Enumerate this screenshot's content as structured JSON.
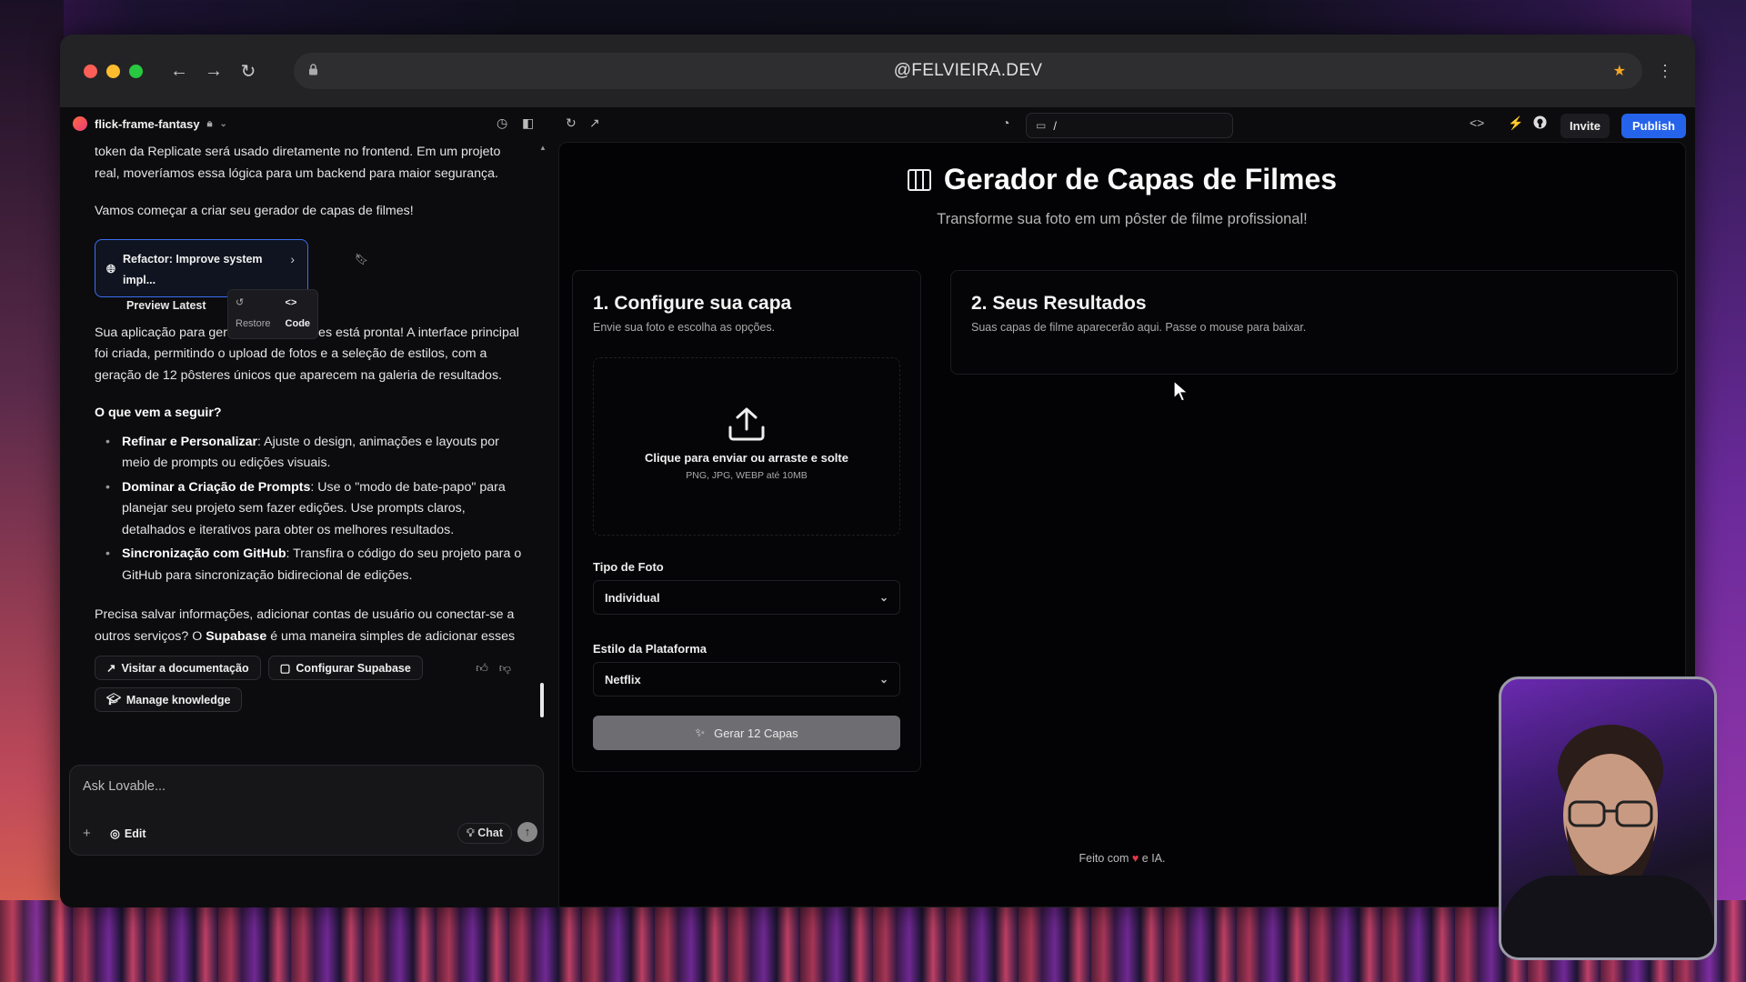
{
  "browser": {
    "url": "@FELVIEIRA.DEV"
  },
  "topbar": {
    "project_name": "flick-frame-fantasy",
    "route": "/",
    "invite_label": "Invite",
    "publish_label": "Publish"
  },
  "chat": {
    "paragraph1": "token da Replicate será usado diretamente no frontend. Em um projeto real, moveríamos essa lógica para um backend para maior segurança.",
    "paragraph2": "Vamos começar a criar seu gerador de capas de filmes!",
    "version_card": {
      "title": "Refactor: Improve system impl...",
      "subtitle": "Preview Latest",
      "restore_label": "Restore",
      "code_label": "Code"
    },
    "paragraph3": "Sua aplicação para gerar capas de filmes está pronta! A interface principal foi criada, permitindo o upload de fotos e a seleção de estilos, com a geração de 12 pôsteres únicos que aparecem na galeria de resultados.",
    "next_heading": "O que vem a seguir?",
    "bullets": [
      {
        "bold": "Refinar e Personalizar",
        "text": ": Ajuste o design, animações e layouts por meio de prompts ou edições visuais."
      },
      {
        "bold": "Dominar a Criação de Prompts",
        "text": ": Use o \"modo de bate-papo\" para planejar seu projeto sem fazer edições. Use prompts claros, detalhados e iterativos para obter os melhores resultados."
      },
      {
        "bold": "Sincronização com GitHub",
        "text": ": Transfira o código do seu projeto para o GitHub para sincronização bidirecional de edições."
      }
    ],
    "paragraph4_pre": "Precisa salvar informações, adicionar contas de usuário ou conectar-se a outros serviços? O ",
    "paragraph4_bold": "Supabase",
    "paragraph4_post": " é uma maneira simples de adicionar esses recursos sem configuração técnica complexa.",
    "buttons": {
      "docs": "Visitar a documentação",
      "supabase": "Configurar Supabase",
      "knowledge": "Manage knowledge"
    },
    "input": {
      "placeholder": "Ask Lovable...",
      "edit_label": "Edit",
      "chat_label": "Chat"
    }
  },
  "preview": {
    "title": "Gerador de Capas de Filmes",
    "subtitle": "Transforme sua foto em um pôster de filme profissional!",
    "config_card": {
      "heading": "1. Configure sua capa",
      "description": "Envie sua foto e escolha as opções.",
      "upload_main": "Clique para enviar ou arraste e solte",
      "upload_hint": "PNG, JPG, WEBP até 10MB",
      "photo_type_label": "Tipo de Foto",
      "photo_type_value": "Individual",
      "platform_label": "Estilo da Plataforma",
      "platform_value": "Netflix",
      "generate_label": "Gerar 12 Capas"
    },
    "results_card": {
      "heading": "2. Seus Resultados",
      "description": "Suas capas de filme aparecerão aqui. Passe o mouse para baixar."
    },
    "footer_pre": "Feito com",
    "footer_post": "e IA."
  }
}
